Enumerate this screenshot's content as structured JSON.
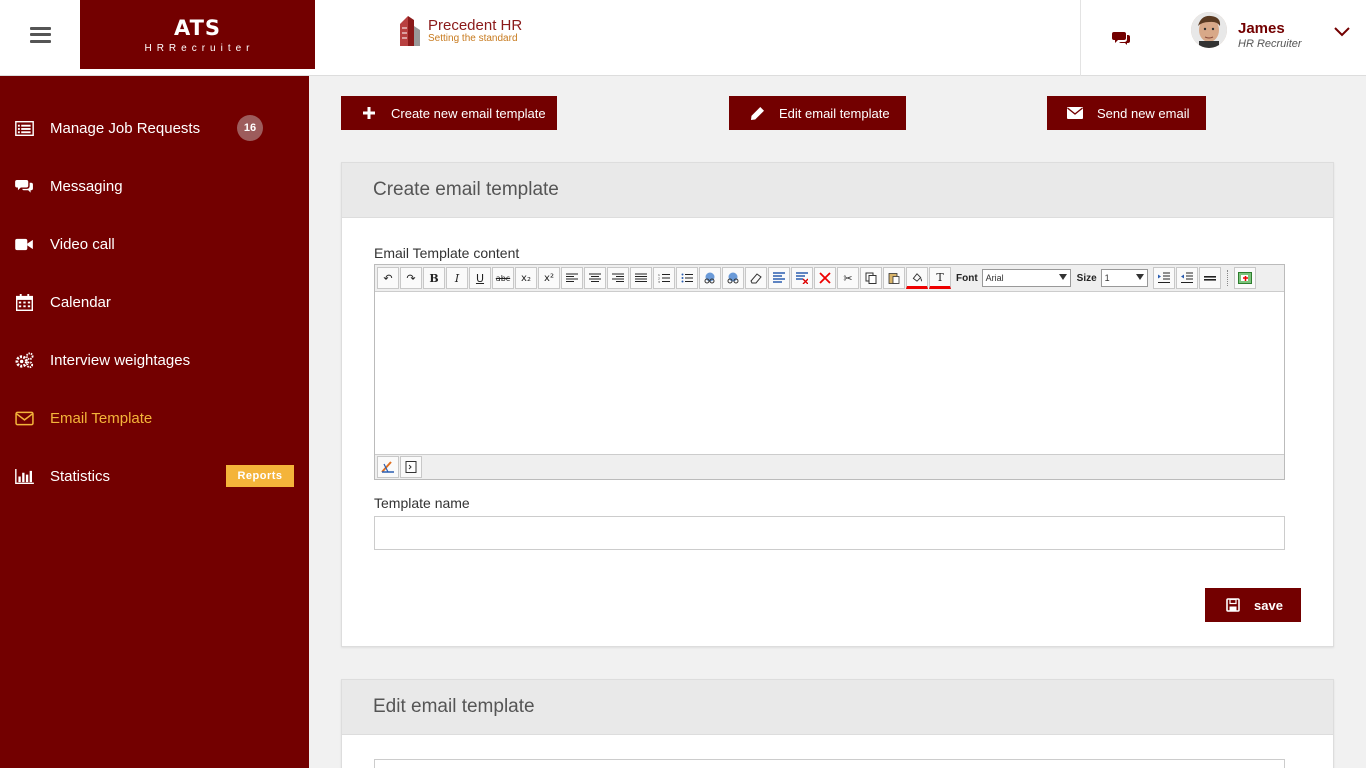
{
  "brand": {
    "title": "ATS",
    "subtitle": "HRRecruiter"
  },
  "logo": {
    "name": "Precedent HR",
    "tagline": "Setting the standard"
  },
  "user": {
    "name": "James",
    "role": "HR Recruiter"
  },
  "sidebar": {
    "items": [
      {
        "label": "Manage Job Requests",
        "icon": "list-icon",
        "badge": "16"
      },
      {
        "label": "Messaging",
        "icon": "chat-icon"
      },
      {
        "label": "Video call",
        "icon": "video-camera-icon"
      },
      {
        "label": "Calendar",
        "icon": "calendar-icon"
      },
      {
        "label": "Interview weightages",
        "icon": "gears-icon"
      },
      {
        "label": "Email Template",
        "icon": "envelope-icon",
        "active": true
      },
      {
        "label": "Statistics",
        "icon": "bar-chart-icon",
        "badge": "Reports"
      }
    ]
  },
  "actions": {
    "create": "Create new email template",
    "edit": "Edit email template",
    "send": "Send new email"
  },
  "create_panel": {
    "title": "Create email template",
    "content_label": "Email Template content",
    "name_label": "Template name",
    "name_value": "",
    "save_label": "save"
  },
  "editor": {
    "font_label": "Font",
    "font_value": "Arial",
    "size_label": "Size",
    "size_value": "1"
  },
  "edit_panel": {
    "title": "Edit email template"
  },
  "colors": {
    "primary": "#730000",
    "accent": "#f4b43a",
    "background": "#f1f1f1"
  }
}
